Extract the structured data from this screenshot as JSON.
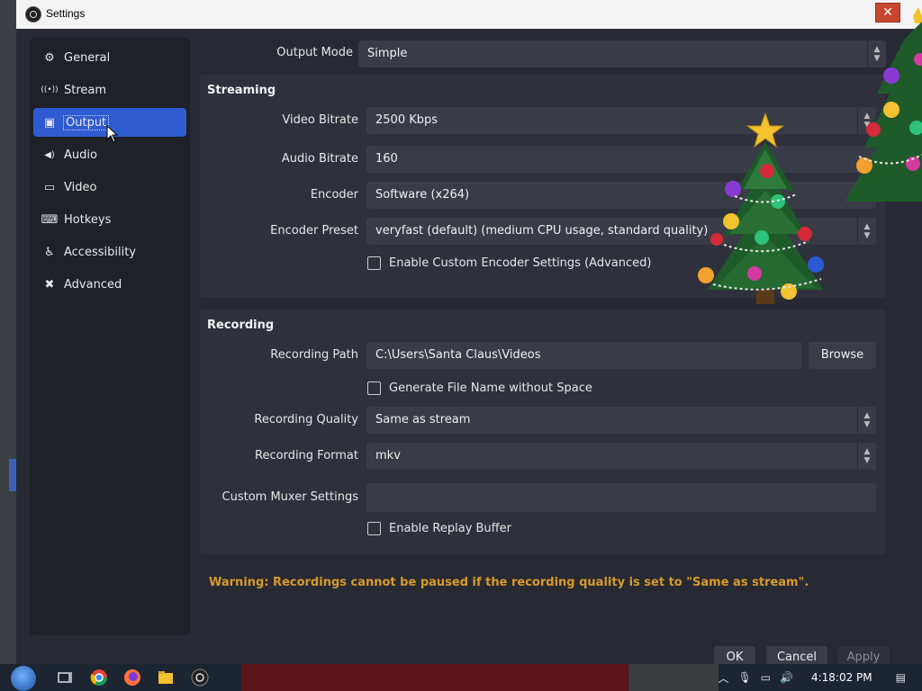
{
  "window": {
    "title": "Settings",
    "close_glyph": "✕"
  },
  "sidebar": {
    "items": [
      {
        "label": "General",
        "icon": "gear-icon",
        "glyph": "⚙"
      },
      {
        "label": "Stream",
        "icon": "antenna-icon",
        "glyph": "((•))"
      },
      {
        "label": "Output",
        "icon": "output-icon",
        "glyph": "▣"
      },
      {
        "label": "Audio",
        "icon": "speaker-icon",
        "glyph": "◀)"
      },
      {
        "label": "Video",
        "icon": "monitor-icon",
        "glyph": "▭"
      },
      {
        "label": "Hotkeys",
        "icon": "keyboard-icon",
        "glyph": "⌨"
      },
      {
        "label": "Accessibility",
        "icon": "accessibility-icon",
        "glyph": "♿"
      },
      {
        "label": "Advanced",
        "icon": "tools-icon",
        "glyph": "✖"
      }
    ],
    "active": "Output"
  },
  "output_mode": {
    "label": "Output Mode",
    "value": "Simple"
  },
  "streaming": {
    "title": "Streaming",
    "video_bitrate": {
      "label": "Video Bitrate",
      "value": "2500 Kbps"
    },
    "audio_bitrate": {
      "label": "Audio Bitrate",
      "value": "160"
    },
    "encoder": {
      "label": "Encoder",
      "value": "Software (x264)"
    },
    "encoder_preset": {
      "label": "Encoder Preset",
      "value": "veryfast (default) (medium CPU usage, standard quality)"
    },
    "custom_encoder": {
      "label": "Enable Custom Encoder Settings (Advanced)",
      "checked": false
    }
  },
  "recording": {
    "title": "Recording",
    "path": {
      "label": "Recording Path",
      "value": "C:\\Users\\Santa Claus\\Videos",
      "browse": "Browse"
    },
    "filename_nospace": {
      "label": "Generate File Name without Space",
      "checked": false
    },
    "quality": {
      "label": "Recording Quality",
      "value": "Same as stream"
    },
    "format": {
      "label": "Recording Format",
      "value": "mkv"
    },
    "muxer": {
      "label": "Custom Muxer Settings",
      "value": ""
    },
    "replay_buffer": {
      "label": "Enable Replay Buffer",
      "checked": false
    }
  },
  "warning": "Warning: Recordings cannot be paused if the recording quality is set to \"Same as stream\".",
  "buttons": {
    "ok": "OK",
    "cancel": "Cancel",
    "apply": "Apply"
  },
  "taskbar": {
    "time": "4:18:02 PM"
  },
  "colors": {
    "accent": "#2f5bd1",
    "warning": "#d89a2b",
    "background": "#272a33",
    "sidebar": "#1f2129",
    "field": "#393c46"
  }
}
